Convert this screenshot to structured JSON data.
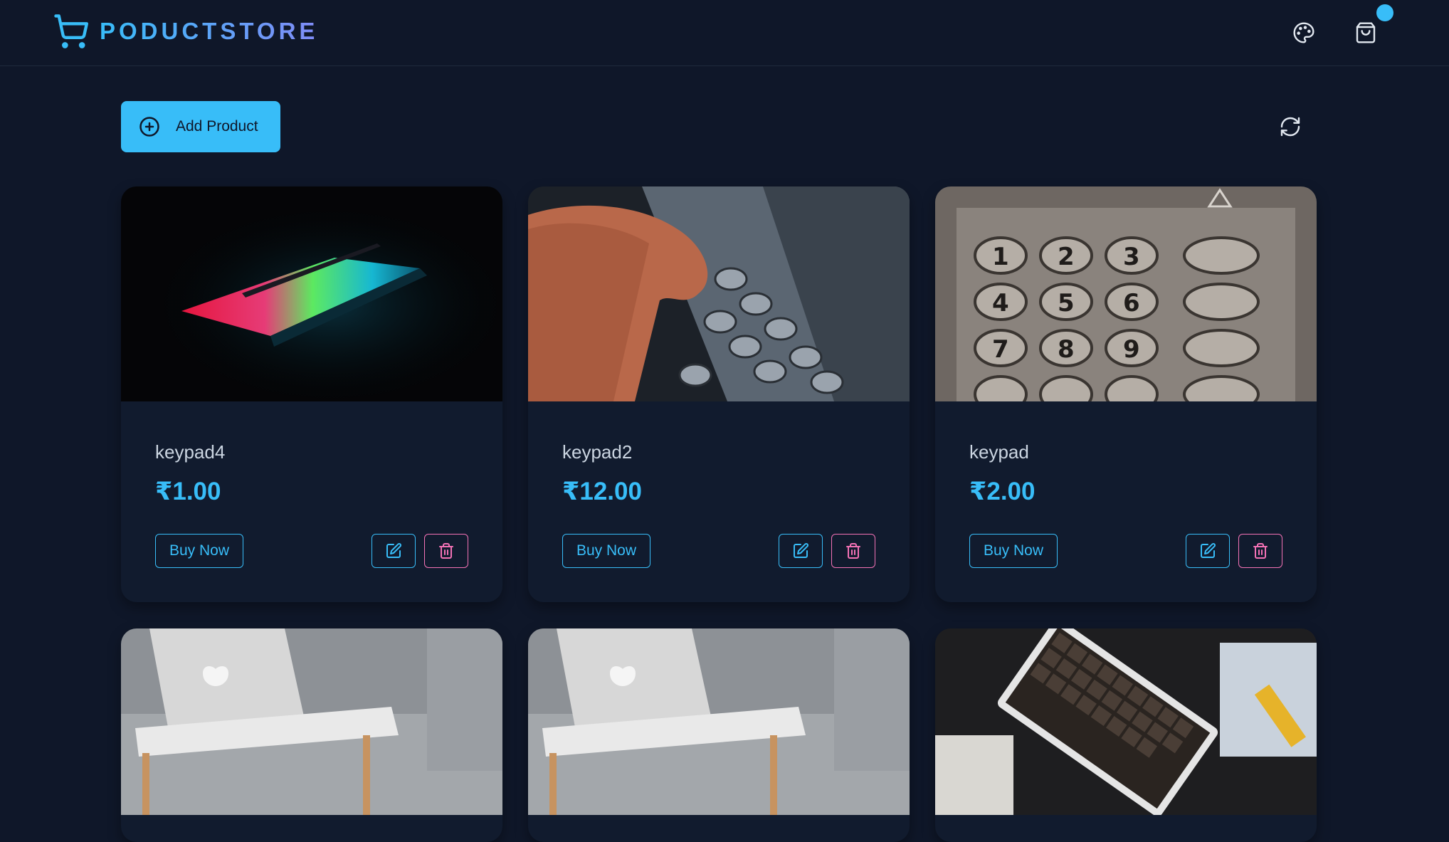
{
  "brand": {
    "name": "PODUCTSTORE"
  },
  "navbar": {
    "theme_icon": "palette-icon",
    "cart_icon": "shopping-bag-icon"
  },
  "toolbar": {
    "add_label": "Add Product",
    "refresh_icon": "refresh-icon"
  },
  "colors": {
    "accent": "#38bdf8",
    "danger": "#f472b6",
    "background": "#0f1729",
    "card": "#111b2e"
  },
  "products": [
    {
      "name": "keypad4",
      "price": "₹1.00",
      "buy_label": "Buy Now",
      "image": "laptop-dark-rgb"
    },
    {
      "name": "keypad2",
      "price": "₹12.00",
      "buy_label": "Buy Now",
      "image": "hand-atm-keypad"
    },
    {
      "name": "keypad",
      "price": "₹2.00",
      "buy_label": "Buy Now",
      "image": "atm-keypad-closeup"
    },
    {
      "name": "",
      "price": "",
      "buy_label": "",
      "image": "laptop-on-tray-sofa"
    },
    {
      "name": "",
      "price": "",
      "buy_label": "",
      "image": "laptop-on-tray-sofa"
    },
    {
      "name": "",
      "price": "",
      "buy_label": "",
      "image": "mechanical-keyboards"
    }
  ]
}
